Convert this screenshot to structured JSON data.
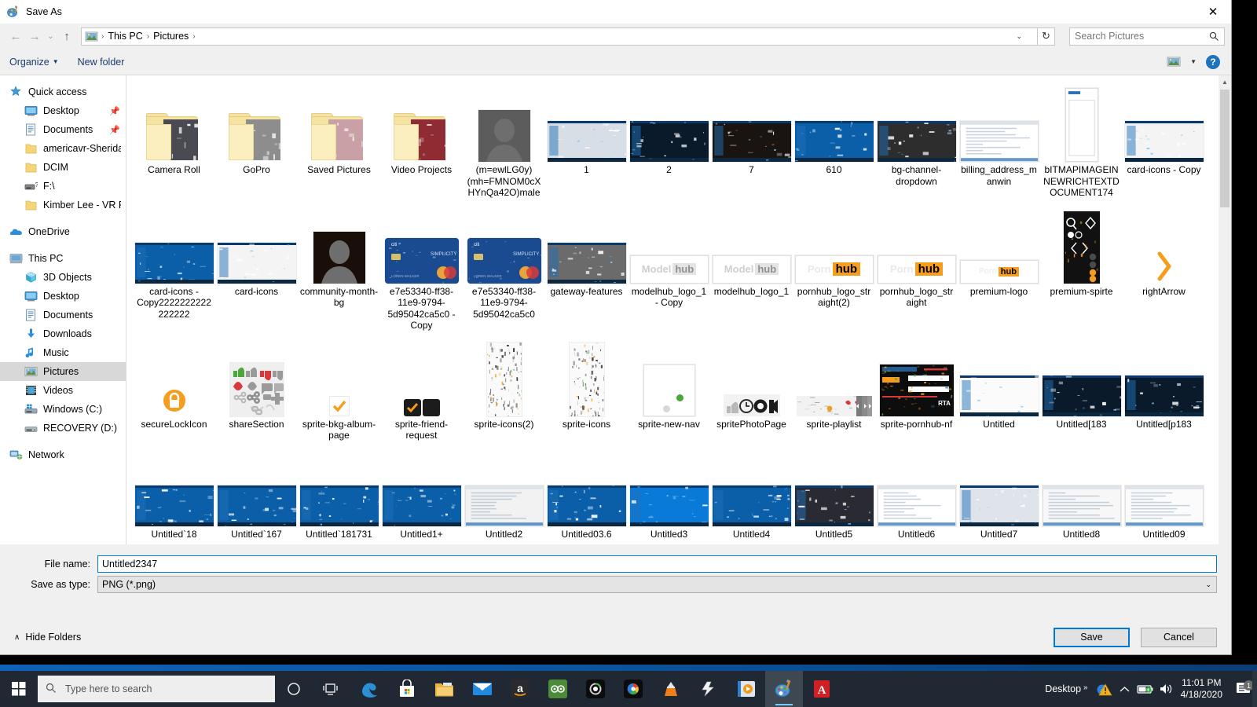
{
  "window": {
    "title": "Save As",
    "app_icon": "paint-icon",
    "close_label": "✕"
  },
  "nav": {
    "back_icon": "arrow-left-icon",
    "forward_icon": "arrow-right-icon",
    "recent_icon": "chevron-down-icon",
    "up_icon": "arrow-up-icon",
    "breadcrumb_icon": "pictures-folder-icon",
    "breadcrumb": [
      "This PC",
      "Pictures"
    ],
    "separator": "›",
    "dropdown_caret": "⌄",
    "refresh_icon": "↻",
    "search_placeholder": "Search Pictures",
    "search_icon": "search-icon"
  },
  "toolbar": {
    "organize_label": "Organize",
    "organize_caret": "▼",
    "new_folder_label": "New folder",
    "view_icon": "view-layout-icon",
    "view_caret": "▼",
    "help_label": "?"
  },
  "sidebar": {
    "groups": [
      {
        "name": "Quick access",
        "icon": "star-pin-icon",
        "items": [
          {
            "label": "Desktop",
            "icon": "monitor-icon",
            "pinned": "📌"
          },
          {
            "label": "Documents",
            "icon": "document-icon",
            "pinned": "📌"
          },
          {
            "label": "americavr-Sheridan",
            "icon": "folder-icon",
            "pinned": ""
          },
          {
            "label": "DCIM",
            "icon": "folder-icon",
            "pinned": ""
          },
          {
            "label": "F:\\",
            "icon": "drive-unknown-icon",
            "pinned": ""
          },
          {
            "label": "Kimber Lee - VR Pac",
            "icon": "folder-icon",
            "pinned": ""
          }
        ]
      },
      {
        "name": "OneDrive",
        "icon": "onedrive-cloud-icon",
        "items": []
      },
      {
        "name": "This PC",
        "icon": "computer-icon",
        "items": [
          {
            "label": "3D Objects",
            "icon": "cube-icon",
            "pinned": ""
          },
          {
            "label": "Desktop",
            "icon": "monitor-icon",
            "pinned": ""
          },
          {
            "label": "Documents",
            "icon": "document-icon",
            "pinned": ""
          },
          {
            "label": "Downloads",
            "icon": "download-arrow-icon",
            "pinned": ""
          },
          {
            "label": "Music",
            "icon": "music-note-icon",
            "pinned": ""
          },
          {
            "label": "Pictures",
            "icon": "pictures-icon",
            "pinned": "",
            "selected": true
          },
          {
            "label": "Videos",
            "icon": "film-icon",
            "pinned": ""
          },
          {
            "label": "Windows (C:)",
            "icon": "windows-drive-icon",
            "pinned": ""
          },
          {
            "label": "RECOVERY (D:)",
            "icon": "drive-icon",
            "pinned": ""
          }
        ]
      },
      {
        "name": "Network",
        "icon": "network-icon",
        "items": []
      }
    ]
  },
  "files": [
    {
      "name": "Camera Roll",
      "kind": "folder",
      "color": "#4a4a52"
    },
    {
      "name": "GoPro",
      "kind": "folder",
      "color": "#8d8d8d"
    },
    {
      "name": "Saved Pictures",
      "kind": "folder",
      "color": "#c8a0a5"
    },
    {
      "name": "Video Projects",
      "kind": "folder",
      "color": "#8e2b33"
    },
    {
      "name": "(m=ewlLG0y)(mh=FMNOM0cXHYnQa42O)male",
      "kind": "image",
      "shape": "sq",
      "color": "#5c5c5c"
    },
    {
      "name": "1",
      "kind": "image",
      "shape": "wide",
      "color": "#d8dee6"
    },
    {
      "name": "2",
      "kind": "image",
      "shape": "wide",
      "color": "#0b1a2b"
    },
    {
      "name": "7",
      "kind": "image",
      "shape": "wide",
      "color": "#1a1410"
    },
    {
      "name": "610",
      "kind": "image",
      "shape": "wide",
      "color": "#0a5fa8"
    },
    {
      "name": "bg-channel-dropdown",
      "kind": "image",
      "shape": "wide",
      "color": "#2d2d2d"
    },
    {
      "name": "billing_address_manwin",
      "kind": "image",
      "shape": "paper",
      "color": "#ffffff"
    },
    {
      "name": "bITMAPIMAGEINNEWRICHTEXTDOCUMENT174",
      "kind": "image",
      "shape": "tall",
      "color": "#ffffff"
    },
    {
      "name": "card-icons - Copy",
      "kind": "image",
      "shape": "wide",
      "color": "#f4f4f4"
    },
    {
      "name": "card-icons - Copy2222222222222222",
      "kind": "image",
      "shape": "wide",
      "color": "#0a5fa8"
    },
    {
      "name": "card-icons",
      "kind": "image",
      "shape": "wide",
      "color": "#f4f4f4"
    },
    {
      "name": "community-month-bg",
      "kind": "image",
      "shape": "sq",
      "color": "#1a0e08"
    },
    {
      "name": "e7e53340-ff38-11e9-9794-5d95042ca5c0 - Copy",
      "kind": "image",
      "shape": "card",
      "color": "#1a4a8f"
    },
    {
      "name": "e7e53340-ff38-11e9-9794-5d95042ca5c0",
      "kind": "image",
      "shape": "card",
      "color": "#1a4a8f"
    },
    {
      "name": "gateway-features",
      "kind": "image",
      "shape": "avatars",
      "color": "#6b6b6b"
    },
    {
      "name": "modelhub_logo_1 - Copy",
      "kind": "logo-modelhub",
      "color": "#d8d8d8"
    },
    {
      "name": "modelhub_logo_1",
      "kind": "logo-modelhub",
      "color": "#d8d8d8"
    },
    {
      "name": "pornhub_logo_straight(2)",
      "kind": "logo-hub",
      "color": "#f79d1e"
    },
    {
      "name": "pornhub_logo_straight",
      "kind": "logo-hub",
      "color": "#f79d1e"
    },
    {
      "name": "premium-logo",
      "kind": "logo-hub-sm",
      "color": "#f79d1e"
    },
    {
      "name": "premium-spirte",
      "kind": "sprite-dark",
      "color": "#111111"
    },
    {
      "name": "rightArrow",
      "kind": "arrow",
      "color": "#f79d1e"
    },
    {
      "name": "secureLockIcon",
      "kind": "lock",
      "color": "#f79d1e"
    },
    {
      "name": "shareSection",
      "kind": "sprite-share",
      "color": "#efefef"
    },
    {
      "name": "sprite-bkg-album-page",
      "kind": "check",
      "color": "#f79d1e"
    },
    {
      "name": "sprite-friend-request",
      "kind": "check-dark",
      "color": "#1c1c1c"
    },
    {
      "name": "sprite-icons(2)",
      "kind": "sprite-tall",
      "color": "#fafafa"
    },
    {
      "name": "sprite-icons",
      "kind": "sprite-tall",
      "color": "#fafafa"
    },
    {
      "name": "sprite-new-nav",
      "kind": "white-dot",
      "color": "#ffffff"
    },
    {
      "name": "spritePhotoPage",
      "kind": "sprite-photo",
      "color": "#f2f2f2"
    },
    {
      "name": "sprite-playlist",
      "kind": "sprite-playlist",
      "color": "#f2f2f2"
    },
    {
      "name": "sprite-pornhub-nf",
      "kind": "sprite-ph",
      "color": "#0d0d0d"
    },
    {
      "name": "Untitled",
      "kind": "image",
      "shape": "wide",
      "color": "#fbfbfb"
    },
    {
      "name": "Untitled[183",
      "kind": "image",
      "shape": "wide",
      "color": "#0b1a2b"
    },
    {
      "name": "Untitled[p183",
      "kind": "image",
      "shape": "wide",
      "color": "#0b1a2b"
    },
    {
      "name": "Untitled`18",
      "kind": "image",
      "shape": "wide",
      "color": "#0a5fa8"
    },
    {
      "name": "Untitled`167",
      "kind": "image",
      "shape": "wide",
      "color": "#0a5fa8"
    },
    {
      "name": "Untitled`181731",
      "kind": "image",
      "shape": "wide",
      "color": "#0a5fa8"
    },
    {
      "name": "Untitled1+",
      "kind": "image",
      "shape": "wide",
      "color": "#0a5fa8"
    },
    {
      "name": "Untitled2",
      "kind": "image",
      "shape": "paper",
      "color": "#f2f2f2"
    },
    {
      "name": "Untitled03.6",
      "kind": "image",
      "shape": "wide",
      "color": "#0a5fa8"
    },
    {
      "name": "Untitled3",
      "kind": "image",
      "shape": "wide",
      "color": "#0a7ad8"
    },
    {
      "name": "Untitled4",
      "kind": "image",
      "shape": "wide",
      "color": "#0a5fa8"
    },
    {
      "name": "Untitled5",
      "kind": "image",
      "shape": "wide",
      "color": "#2a2a33"
    },
    {
      "name": "Untitled6",
      "kind": "image",
      "shape": "paper",
      "color": "#ffffff"
    },
    {
      "name": "Untitled7",
      "kind": "image",
      "shape": "wide",
      "color": "#dfe4ea"
    },
    {
      "name": "Untitled8",
      "kind": "image",
      "shape": "paper",
      "color": "#f7f7f7"
    },
    {
      "name": "Untitled09",
      "kind": "image",
      "shape": "paper",
      "color": "#fbfbfb"
    }
  ],
  "partial_row": [
    {
      "color": "#2b1030"
    },
    {
      "color": "#e9d3d3"
    },
    {
      "color": "#4a1d55"
    },
    {
      "color": "#f4f6f8"
    },
    {
      "color": "#ececec"
    },
    {
      "color": "#e8eef4"
    },
    {
      "color": "#0d0d0d"
    },
    {
      "color": "#1d7a2a"
    },
    {
      "color": "#1d4a2a"
    },
    {
      "color": "#efe4de"
    },
    {
      "color": "#dfe6ee"
    },
    {
      "color": "#0a5fa8"
    }
  ],
  "form": {
    "filename_label": "File name:",
    "filename_value": "Untitled2347",
    "savetype_label": "Save as type:",
    "savetype_value": "PNG (*.png)",
    "savetype_caret": "⌄"
  },
  "footer": {
    "hide_folders_label": "Hide Folders",
    "hide_folders_caret": "∧",
    "save_label": "Save",
    "cancel_label": "Cancel"
  },
  "taskbar": {
    "start_icon": "windows-start-icon",
    "search_placeholder": "Type here to search",
    "search_icon": "search-icon",
    "items": [
      {
        "icon": "cortana-icon"
      },
      {
        "icon": "task-view-icon"
      },
      {
        "icon": "edge-icon"
      },
      {
        "icon": "microsoft-store-icon"
      },
      {
        "icon": "file-explorer-icon"
      },
      {
        "icon": "mail-icon"
      },
      {
        "icon": "amazon-icon"
      },
      {
        "icon": "tripadvisor-icon"
      },
      {
        "icon": "camera-app-icon"
      },
      {
        "icon": "color-wheel-app-icon"
      },
      {
        "icon": "vlc-icon"
      },
      {
        "icon": "winamp-icon"
      },
      {
        "icon": "media-player-icon"
      },
      {
        "icon": "paint-icon"
      },
      {
        "icon": "acrobat-reader-icon"
      }
    ],
    "tray": {
      "desktop_label": "Desktop",
      "desktop_chevron": "»",
      "warning_icon": "warning-triangle-icon",
      "expand_icon": "chevron-up-icon",
      "battery_icon": "battery-icon",
      "volume_icon": "speaker-icon",
      "time": "11:01 PM",
      "date": "4/18/2020",
      "notification_icon": "action-center-icon",
      "notification_count": "1"
    }
  },
  "colors": {
    "accent": "#0078d7",
    "taskbar": "#1f2833",
    "dialog_bg": "#f0f0f0",
    "folder": "#f6e3a0",
    "brand_orange": "#f79d1e"
  }
}
